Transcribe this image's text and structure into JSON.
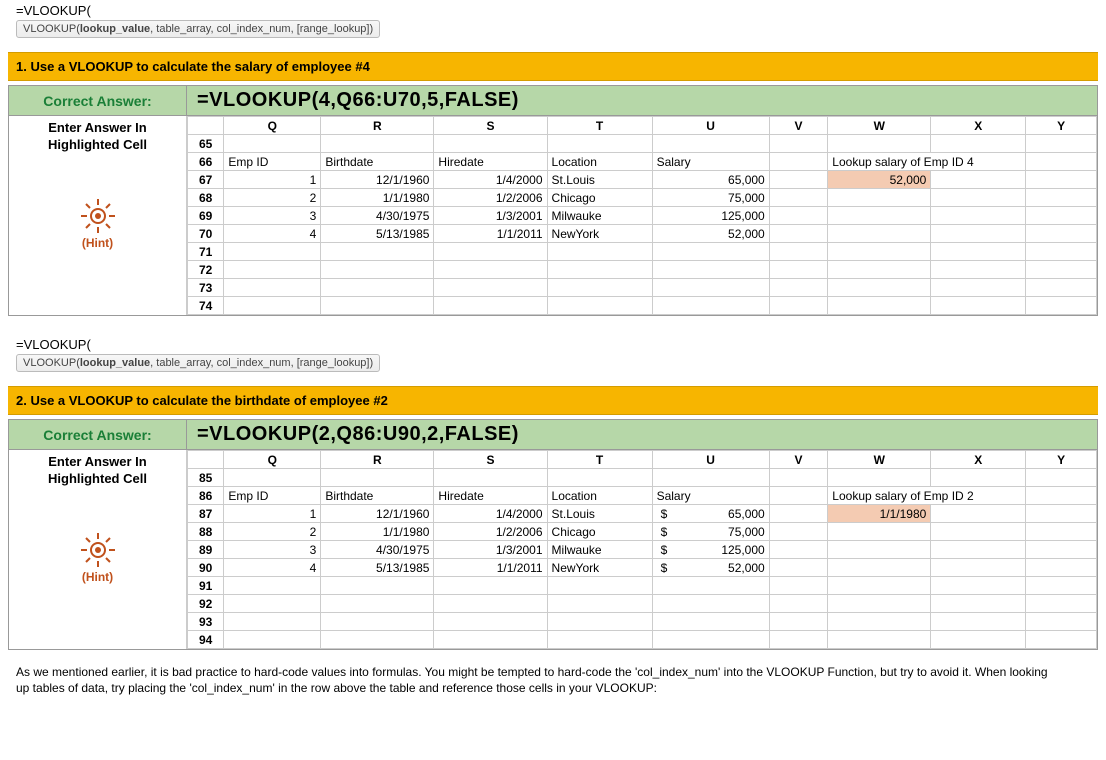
{
  "formula_bar": "=VLOOKUP(",
  "tooltip": {
    "fn": "VLOOKUP",
    "args_bold": "lookup_value",
    "args_rest": ", table_array, col_index_num, [range_lookup])"
  },
  "section1": {
    "question": "1. Use a VLOOKUP to calculate the salary of employee #4",
    "correct_label": "Correct Answer:",
    "formula": "=VLOOKUP(4,Q66:U70,5,FALSE)",
    "enter_label1": "Enter Answer In",
    "enter_label2": "Highlighted Cell",
    "hint_label": "(Hint)",
    "cols": [
      "Q",
      "R",
      "S",
      "T",
      "U",
      "V",
      "W",
      "X",
      "Y"
    ],
    "rows": [
      "65",
      "66",
      "67",
      "68",
      "69",
      "70",
      "71",
      "72",
      "73",
      "74"
    ],
    "headers": {
      "Q": "Emp ID",
      "R": "Birthdate",
      "S": "Hiredate",
      "T": "Location",
      "U": "Salary",
      "W": "Lookup salary of Emp ID 4"
    },
    "data": [
      {
        "Q": "1",
        "R": "12/1/1960",
        "S": "1/4/2000",
        "T": "St.Louis",
        "U": "65,000"
      },
      {
        "Q": "2",
        "R": "1/1/1980",
        "S": "1/2/2006",
        "T": "Chicago",
        "U": "75,000"
      },
      {
        "Q": "3",
        "R": "4/30/1975",
        "S": "1/3/2001",
        "T": "Milwauke",
        "U": "125,000"
      },
      {
        "Q": "4",
        "R": "5/13/1985",
        "S": "1/1/2011",
        "T": "NewYork",
        "U": "52,000"
      }
    ],
    "result": "52,000"
  },
  "section2": {
    "question": "2. Use a VLOOKUP to calculate the birthdate of employee #2",
    "correct_label": "Correct Answer:",
    "formula": "=VLOOKUP(2,Q86:U90,2,FALSE)",
    "enter_label1": "Enter Answer In",
    "enter_label2": "Highlighted Cell",
    "hint_label": "(Hint)",
    "cols": [
      "Q",
      "R",
      "S",
      "T",
      "U",
      "V",
      "W",
      "X",
      "Y"
    ],
    "rows": [
      "85",
      "86",
      "87",
      "88",
      "89",
      "90",
      "91",
      "92",
      "93",
      "94"
    ],
    "headers": {
      "Q": "Emp ID",
      "R": "Birthdate",
      "S": "Hiredate",
      "T": "Location",
      "U": "Salary",
      "W": "Lookup salary of Emp ID 2"
    },
    "data": [
      {
        "Q": "1",
        "R": "12/1/1960",
        "S": "1/4/2000",
        "T": "St.Louis",
        "U_sym": "$",
        "U": "65,000"
      },
      {
        "Q": "2",
        "R": "1/1/1980",
        "S": "1/2/2006",
        "T": "Chicago",
        "U_sym": "$",
        "U": "75,000"
      },
      {
        "Q": "3",
        "R": "4/30/1975",
        "S": "1/3/2001",
        "T": "Milwauke",
        "U_sym": "$",
        "U": "125,000"
      },
      {
        "Q": "4",
        "R": "5/13/1985",
        "S": "1/1/2011",
        "T": "NewYork",
        "U_sym": "$",
        "U": "52,000"
      }
    ],
    "result": "1/1/1980"
  },
  "explainer": "As we mentioned earlier, it is bad practice to hard-code values into formulas. You might be tempted to hard-code the 'col_index_num' into the VLOOKUP Function, but try to avoid it. When looking up tables of data, try placing the 'col_index_num' in the row above the table and reference those cells in your VLOOKUP:"
}
